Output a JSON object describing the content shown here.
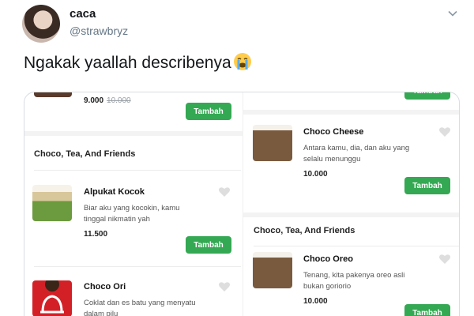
{
  "tweet": {
    "display_name": "caca",
    "handle": "@strawbryz",
    "text": "Ngakak yaallah describenya",
    "emoji": "loudly-crying-face"
  },
  "menu": {
    "top_item": {
      "price": "9.000",
      "old_price": "10.000",
      "button": "Tambah"
    },
    "right_top_button": "Tambah",
    "left": {
      "section_title": "Choco, Tea, And Friends",
      "items": [
        {
          "name": "Alpukat Kocok",
          "desc_line1": "Biar aku yang kocokin, kamu",
          "desc_line2": "tinggal nikmatin yah",
          "price": "11.500",
          "button": "Tambah"
        },
        {
          "name": "Choco Ori",
          "desc_line1": "Coklat dan es batu yang menyatu",
          "desc_line2": "dalam pilu"
        }
      ]
    },
    "right": {
      "items_top": [
        {
          "name": "Choco Cheese",
          "desc_line1": "Antara kamu, dia, dan aku yang",
          "desc_line2": "selalu menunggu",
          "price": "10.000",
          "button": "Tambah"
        }
      ],
      "section_title": "Choco, Tea, And Friends",
      "items": [
        {
          "name": "Choco Oreo",
          "desc_line1": "Tenang, kita pakenya oreo asli",
          "desc_line2": "bukan gorioriо",
          "price": "10.000",
          "button": "Tambah"
        }
      ]
    }
  },
  "colors": {
    "accent_green": "#34a853",
    "muted": "#657786"
  }
}
